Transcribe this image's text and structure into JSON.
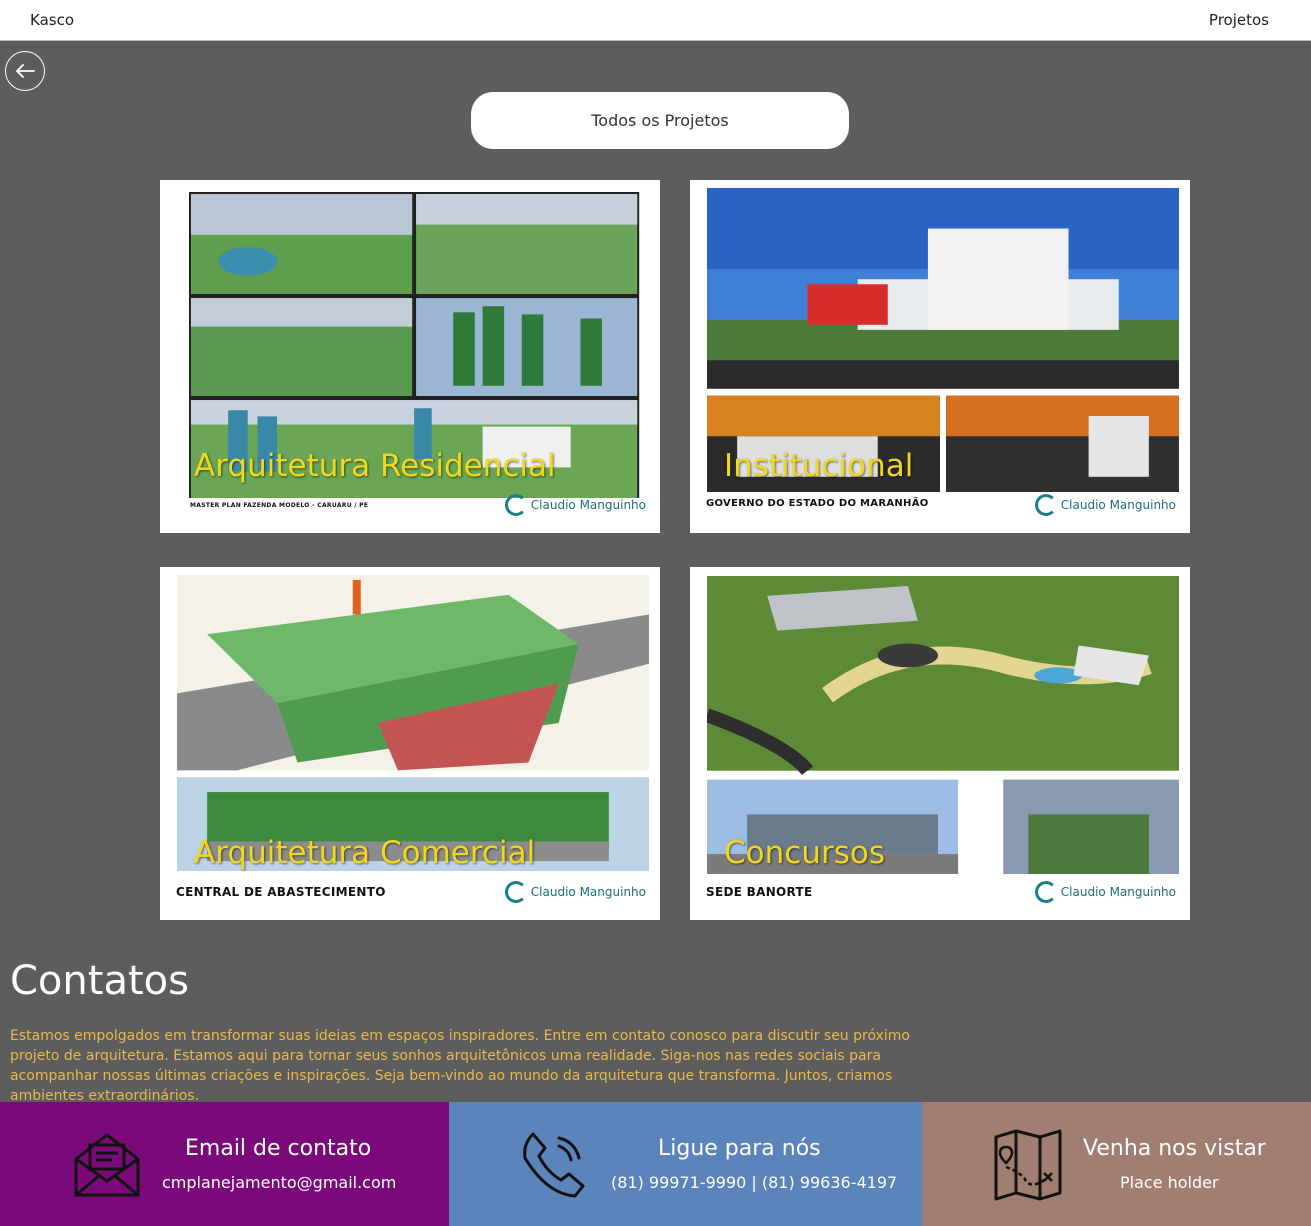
{
  "header": {
    "brand": "Kasco",
    "nav_link": "Projetos"
  },
  "filter": {
    "label": "Todos os Projetos"
  },
  "projects": [
    {
      "title": "Arquitetura Residencial",
      "caption": "MASTER PLAN FAZENDA MODELO - CARUARU / PE",
      "firm": "Claudio Manguinho"
    },
    {
      "title": "Institucional",
      "caption": "GOVERNO DO ESTADO DO MARANHÃO",
      "firm": "Claudio Manguinho"
    },
    {
      "title": "Arquitetura Comercial",
      "caption": "CENTRAL DE ABASTECIMENTO",
      "firm": "Claudio Manguinho"
    },
    {
      "title": "Concursos",
      "caption": "SEDE BANORTE",
      "firm": "Claudio Manguinho"
    }
  ],
  "contacts_section": {
    "title": "Contatos",
    "text": "Estamos empolgados em transformar suas ideias em espaços inspiradores. Entre em contato conosco para discutir seu próximo projeto de arquitetura. Estamos aqui para tornar seus sonhos arquitetônicos uma realidade. Siga-nos nas redes sociais para acompanhar nossas últimas criações e inspirações. Seja bem-vindo ao mundo da arquitetura que transforma. Juntos, criamos ambientes extraordinários."
  },
  "contact_cards": [
    {
      "title": "Email de contato",
      "value": "cmplanejamento@gmail.com",
      "icon": "envelope-icon",
      "color": "#7a0a7a"
    },
    {
      "title": "Ligue para nós",
      "value": "(81) 99971-9990 | (81) 99636-4197",
      "icon": "phone-icon",
      "color": "#5b84bb"
    },
    {
      "title": "Venha nos vistar",
      "value": "Place holder",
      "icon": "map-icon",
      "color": "#a07f72"
    }
  ]
}
